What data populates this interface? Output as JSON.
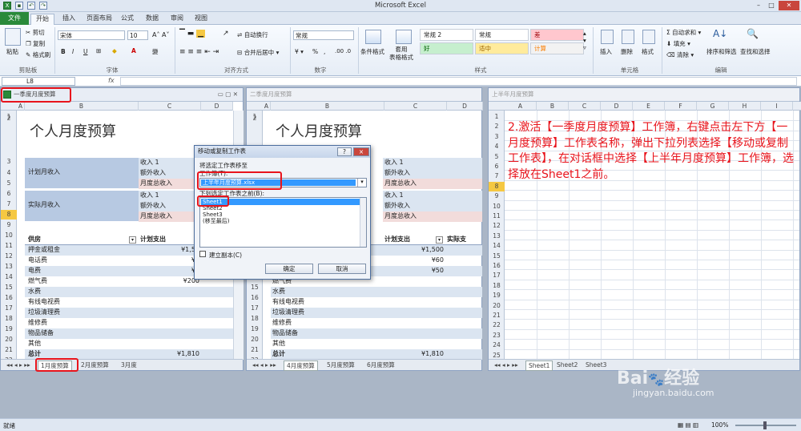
{
  "app": {
    "title": "Microsoft Excel"
  },
  "tabs": {
    "file": "文件",
    "home": "开始",
    "insert": "插入",
    "layout": "页面布局",
    "formulas": "公式",
    "data": "数据",
    "review": "审阅",
    "view": "视图"
  },
  "ribbon": {
    "clipboard": {
      "paste": "粘贴",
      "cut": "剪切",
      "copy": "复制",
      "format_painter": "格式刷",
      "label": "剪贴板"
    },
    "font": {
      "name": "宋体",
      "size": "10",
      "bold": "B",
      "italic": "I",
      "underline": "U",
      "label": "字体"
    },
    "alignment": {
      "wrap": "自动换行",
      "merge": "合并后居中",
      "label": "对齐方式"
    },
    "number": {
      "format": "常规",
      "percent": "%",
      "comma": ",",
      "label": "数字"
    },
    "styles": {
      "conditional": "条件格式",
      "table": "套用\n表格格式",
      "cell_styles": [
        {
          "name": "常规 2",
          "bg": "#ffffff"
        },
        {
          "name": "常规",
          "bg": "#ffffff"
        },
        {
          "name": "差",
          "bg": "#ffc7ce",
          "fg": "#9c0006"
        },
        {
          "name": "好",
          "bg": "#c6efce",
          "fg": "#006100"
        },
        {
          "name": "适中",
          "bg": "#ffeb9c",
          "fg": "#9c6500"
        },
        {
          "name": "计算",
          "bg": "#f2f2f2",
          "fg": "#fa7d00"
        }
      ],
      "label": "样式"
    },
    "cells": {
      "insert": "插入",
      "delete": "删除",
      "format": "格式",
      "label": "单元格"
    },
    "editing": {
      "autosum": "自动求和",
      "fill": "填充",
      "clear": "清除",
      "sort": "排序和筛选",
      "find": "查找和选择",
      "label": "编辑"
    }
  },
  "formula_bar": {
    "name_box": "L8",
    "fx": "fx",
    "content": ""
  },
  "wb1": {
    "title": "一季度月度预算",
    "cols": [
      "A",
      "B",
      "C",
      "D"
    ],
    "heading": "个人月度预算",
    "monthly_income": "计划月收入",
    "actual_income": "实际月收入",
    "income1": "收入 1",
    "extra_income": "额外收入",
    "total_income": "月度总收入",
    "expense_header": "供房",
    "plan_header": "计划支出",
    "rows": [
      {
        "label": "押金或租金",
        "val": "¥1,50"
      },
      {
        "label": "电话费",
        "val": "¥6"
      },
      {
        "label": "电费",
        "val": "¥5"
      },
      {
        "label": "燃气费",
        "val": "¥200"
      },
      {
        "label": "水费",
        "val": ""
      },
      {
        "label": "有线电视费",
        "val": ""
      },
      {
        "label": "垃圾清理费",
        "val": ""
      },
      {
        "label": "维修费",
        "val": ""
      },
      {
        "label": "物品储备",
        "val": ""
      },
      {
        "label": "其他",
        "val": ""
      },
      {
        "label": "总计",
        "val": "¥1,810"
      }
    ],
    "sheets": [
      "1月度预算",
      "2月度预算",
      "3月度"
    ]
  },
  "wb2": {
    "title": "二季度月度预算",
    "cols": [
      "A",
      "B",
      "C",
      "D"
    ],
    "heading": "个人月度预算",
    "income1": "收入 1",
    "extra_income": "额外收入",
    "total_income": "月度总收入",
    "plan_header": "计划支出",
    "actual_header": "实际支",
    "rows": [
      {
        "label": "",
        "val": "¥1,500"
      },
      {
        "label": "",
        "val": "¥60"
      },
      {
        "label": "",
        "val": "¥50"
      },
      {
        "label": "燃气费",
        "val": ""
      },
      {
        "label": "水费",
        "val": ""
      },
      {
        "label": "有线电视费",
        "val": ""
      },
      {
        "label": "垃圾清理费",
        "val": ""
      },
      {
        "label": "维修费",
        "val": ""
      },
      {
        "label": "物品储备",
        "val": ""
      },
      {
        "label": "其他",
        "val": ""
      },
      {
        "label": "总计",
        "val": "¥1,810"
      }
    ],
    "sheets": [
      "4月度预算",
      "5月度预算",
      "6月度预算"
    ]
  },
  "wb3": {
    "title": "上半年月度预算",
    "cols": [
      "A",
      "B",
      "C",
      "D",
      "E",
      "F",
      "G",
      "H",
      "I"
    ],
    "instruction": "2.激活【一季度月度预算】工作簿，右键点击左下方【一月度预算】工作表名称，弹出下拉列表选择【移动或复制工作表】，在对话框中选择【上半年月度预算】工作簿，选择放在Sheet1之前。",
    "sheets": [
      "Sheet1",
      "Sheet2",
      "Sheet3"
    ]
  },
  "dialog": {
    "title": "移动或复制工作表",
    "move_label": "将选定工作表移至",
    "workbook_label": "工作簿(T):",
    "workbook_value": "上半年月度预算.xlsx",
    "before_label": "下列选定工作表之前(B):",
    "list": [
      "Sheet1",
      "Sheet2",
      "Sheet3",
      "(移至最后)"
    ],
    "copy_label": "建立副本(C)",
    "ok": "确定",
    "cancel": "取消",
    "help": "?",
    "close": "×"
  },
  "status": {
    "ready": "就绪",
    "zoom": "100%"
  },
  "watermark": {
    "brand": "Bai",
    "brand2": "经验",
    "url": "jingyan.baidu.com"
  }
}
